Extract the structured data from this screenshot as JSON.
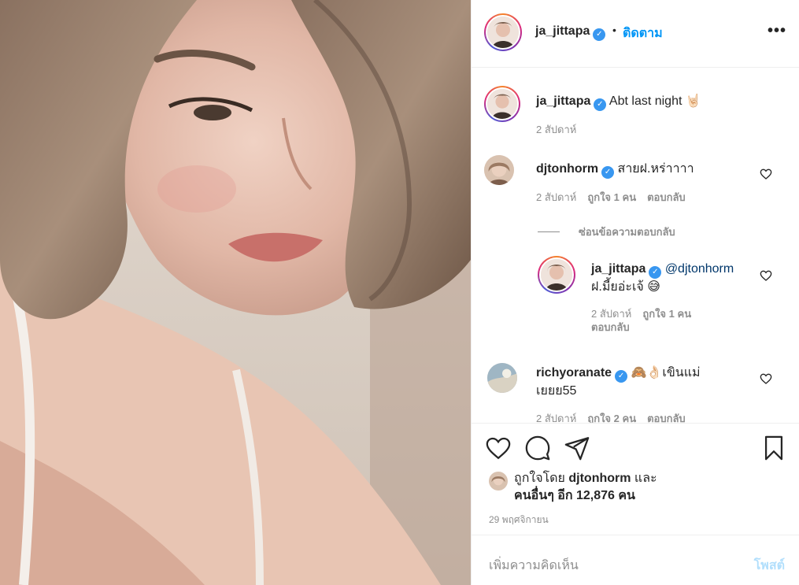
{
  "post": {
    "author": "ja_jittapa",
    "follow_label": "ติดตาม",
    "dot": "•",
    "more_label": "•••"
  },
  "comments": [
    {
      "user": "ja_jittapa",
      "text": "Abt last night 🤘🏻",
      "time": "2 สัปดาห์"
    },
    {
      "user": "djtonhorm",
      "text": "สายฝ.หร่าาาา",
      "time": "2 สัปดาห์",
      "likes": "ถูกใจ 1 คน",
      "reply": "ตอบกลับ"
    },
    {
      "user": "richyoranate",
      "text": "🙈👌🏻เขินแม่เยยย55",
      "time": "2 สัปดาห์",
      "likes": "ถูกใจ 2 คน",
      "reply": "ตอบกลับ"
    }
  ],
  "hide_replies_label": "ซ่อนข้อความตอบกลับ",
  "reply": {
    "user": "ja_jittapa",
    "mention": "@djtonhorm",
    "text": "ฝ.มี้ยอ่ะเจ้ 😅",
    "time": "2 สัปดาห์",
    "likes": "ถูกใจ 1 คน",
    "reply_label": "ตอบกลับ"
  },
  "likes": {
    "prefix": "ถูกใจโดย",
    "user": "djtonhorm",
    "and": "และ",
    "others": "คนอื่นๆ อีก 12,876 คน"
  },
  "date": "29 พฤศจิกายน",
  "add_comment": {
    "placeholder": "เพิ่มความคิดเห็น",
    "post_label": "โพสต์"
  },
  "colors": {
    "accent": "#0095f6",
    "verified": "#3897f0",
    "post_disabled": "#b2dffc",
    "muted": "#8e8e8e"
  }
}
